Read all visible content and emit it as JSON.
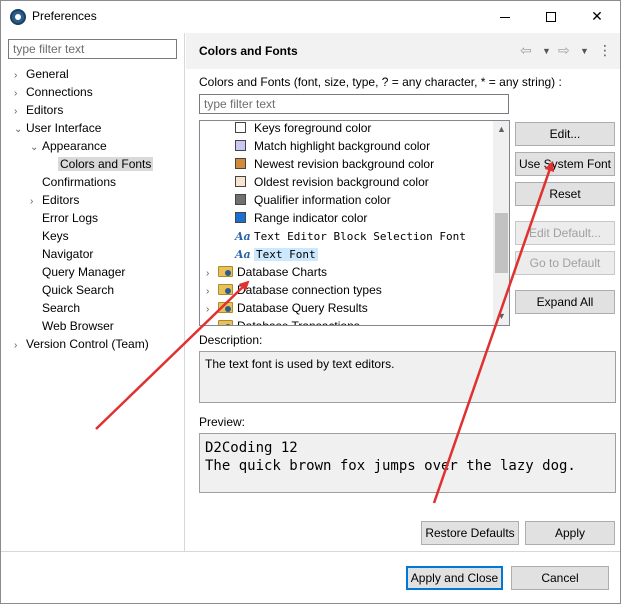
{
  "window": {
    "title": "Preferences",
    "close_glyph": "✕"
  },
  "left": {
    "filter_placeholder": "type filter text",
    "tree": [
      {
        "label": "General",
        "level": 0,
        "expander": "›"
      },
      {
        "label": "Connections",
        "level": 0,
        "expander": "›"
      },
      {
        "label": "Editors",
        "level": 0,
        "expander": "›"
      },
      {
        "label": "User Interface",
        "level": 0,
        "expander": "⌄"
      },
      {
        "label": "Appearance",
        "level": 1,
        "expander": "⌄"
      },
      {
        "label": "Colors and Fonts",
        "level": 2,
        "expander": "",
        "selected": true
      },
      {
        "label": "Confirmations",
        "level": 1,
        "expander": ""
      },
      {
        "label": "Editors",
        "level": 1,
        "expander": "›"
      },
      {
        "label": "Error Logs",
        "level": 1,
        "expander": ""
      },
      {
        "label": "Keys",
        "level": 1,
        "expander": ""
      },
      {
        "label": "Navigator",
        "level": 1,
        "expander": ""
      },
      {
        "label": "Query Manager",
        "level": 1,
        "expander": ""
      },
      {
        "label": "Quick Search",
        "level": 1,
        "expander": ""
      },
      {
        "label": "Search",
        "level": 1,
        "expander": ""
      },
      {
        "label": "Web Browser",
        "level": 1,
        "expander": ""
      },
      {
        "label": "Version Control (Team)",
        "level": 0,
        "expander": "›"
      }
    ]
  },
  "right": {
    "title": "Colors and Fonts",
    "nav": {
      "back_icon": "back-arrow-icon",
      "forward_icon": "forward-arrow-icon",
      "menu_icon": "more-vert-icon"
    },
    "description_line": "Colors and Fonts (font, size, type, ? = any character, * = any string) :",
    "filter_placeholder": "type filter text",
    "list": [
      {
        "type": "color",
        "label": "Keys foreground color",
        "color": "#ffffff"
      },
      {
        "type": "color",
        "label": "Match highlight background color",
        "color": "#c8c8f0"
      },
      {
        "type": "color",
        "label": "Newest revision background color",
        "color": "#d08a3a"
      },
      {
        "type": "color",
        "label": "Oldest revision background color",
        "color": "#f8e4d0"
      },
      {
        "type": "color",
        "label": "Qualifier information color",
        "color": "#707070"
      },
      {
        "type": "color",
        "label": "Range indicator color",
        "color": "#1a6fd0"
      },
      {
        "type": "font",
        "label": "Text Editor Block Selection Font"
      },
      {
        "type": "font",
        "label": "Text Font",
        "selected": true
      },
      {
        "type": "category",
        "label": "Database Charts"
      },
      {
        "type": "category",
        "label": "Database connection types"
      },
      {
        "type": "category",
        "label": "Database Query Results"
      },
      {
        "type": "category",
        "label": "Database Transactions"
      }
    ],
    "buttons": {
      "edit": "Edit...",
      "use_system_font": "Use System Font",
      "reset": "Reset",
      "edit_default": "Edit Default...",
      "go_to_default": "Go to Default",
      "expand_all": "Expand All"
    },
    "description_label": "Description:",
    "description_text": "The text font is used by text editors.",
    "preview_label": "Preview:",
    "preview_line1": "D2Coding 12",
    "preview_line2": "The quick brown fox jumps over the lazy dog.",
    "restore_defaults": "Restore Defaults",
    "apply": "Apply"
  },
  "footer": {
    "apply_and_close": "Apply and Close",
    "cancel": "Cancel"
  },
  "annotation_color": "#e03030"
}
